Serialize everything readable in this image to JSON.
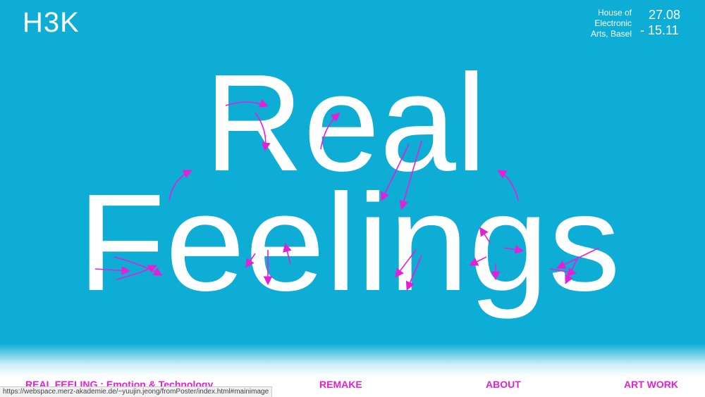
{
  "header": {
    "logo": "H3K",
    "venue_lines": [
      "House of",
      "Electronic",
      "Arts, Basel"
    ],
    "date_start": "27.08",
    "date_end": "- 15.11"
  },
  "poster": {
    "line1": "Real",
    "line2": "Feelings",
    "background_color": "#0dadd6",
    "text_color": "#ffffff",
    "arrow_color": "#e51fd8"
  },
  "nav": {
    "items": [
      {
        "label": "REAL FEELING : Emotion & Technology"
      },
      {
        "label": "REMAKE"
      },
      {
        "label": "ABOUT"
      },
      {
        "label": "ART WORK"
      }
    ]
  },
  "status_bar": {
    "url": "https://webspace.merz-akademie.de/~yuujin.jeong/fromPoster/index.html#mainimage"
  }
}
